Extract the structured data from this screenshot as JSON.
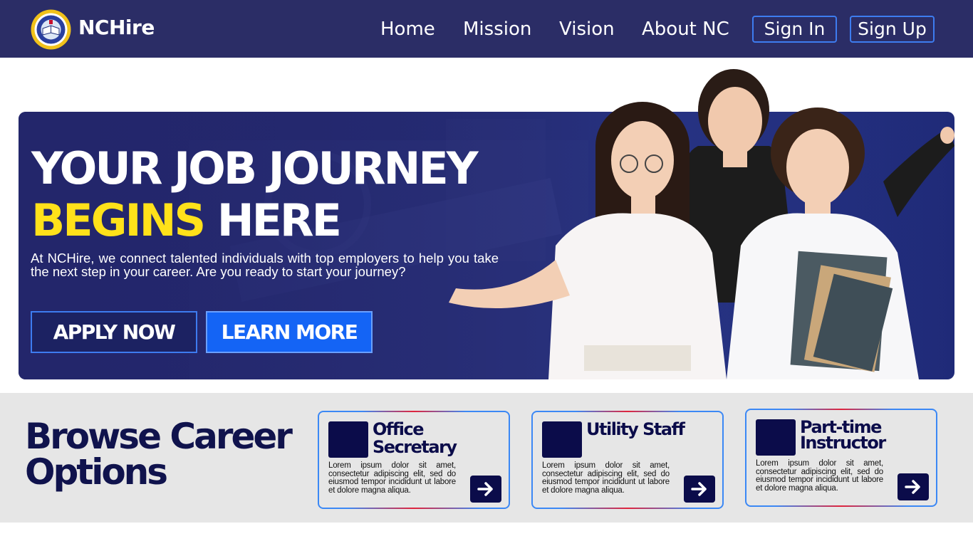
{
  "nav": {
    "brand": "NCHire",
    "logo_icon": "college-seal-logo",
    "links": [
      "Home",
      "Mission",
      "Vision",
      "About NC"
    ],
    "sign_in": "Sign In",
    "sign_up": "Sign Up"
  },
  "hero": {
    "headline_line1": "YOUR JOB JOURNEY",
    "headline_highlight": "BEGINS",
    "headline_rest": " HERE",
    "description": "At NCHire, we connect talented individuals with top employers to help you take the next step in your career. Are you ready to start your journey?",
    "apply_label": "APPLY NOW",
    "learn_label": "LEARN MORE",
    "highlight_color": "#ffe11a",
    "background_color": "#26307a"
  },
  "browse": {
    "title": "Browse Career Options",
    "cards": [
      {
        "title": "Office Secretary",
        "description": "Lorem ipsum dolor sit amet, consectetur adipiscing elit, sed do eiusmod tempor incididunt ut labore et dolore magna aliqua.",
        "arrow_icon": "arrow-right-icon"
      },
      {
        "title": "Utility Staff",
        "description": "Lorem ipsum dolor sit amet, consectetur adipiscing elit, sed do eiusmod tempor incididunt ut labore et dolore magna aliqua.",
        "arrow_icon": "arrow-right-icon"
      },
      {
        "title": "Part-time Instructor",
        "description": "Lorem ipsum dolor sit amet, consectetur adipiscing elit, sed do eiusmod tempor incididunt ut labore et dolore magna aliqua.",
        "arrow_icon": "arrow-right-icon"
      }
    ]
  },
  "colors": {
    "navbar": "#2b2d66",
    "accent_blue": "#1464f5",
    "dark_navy": "#0b0c4a"
  }
}
